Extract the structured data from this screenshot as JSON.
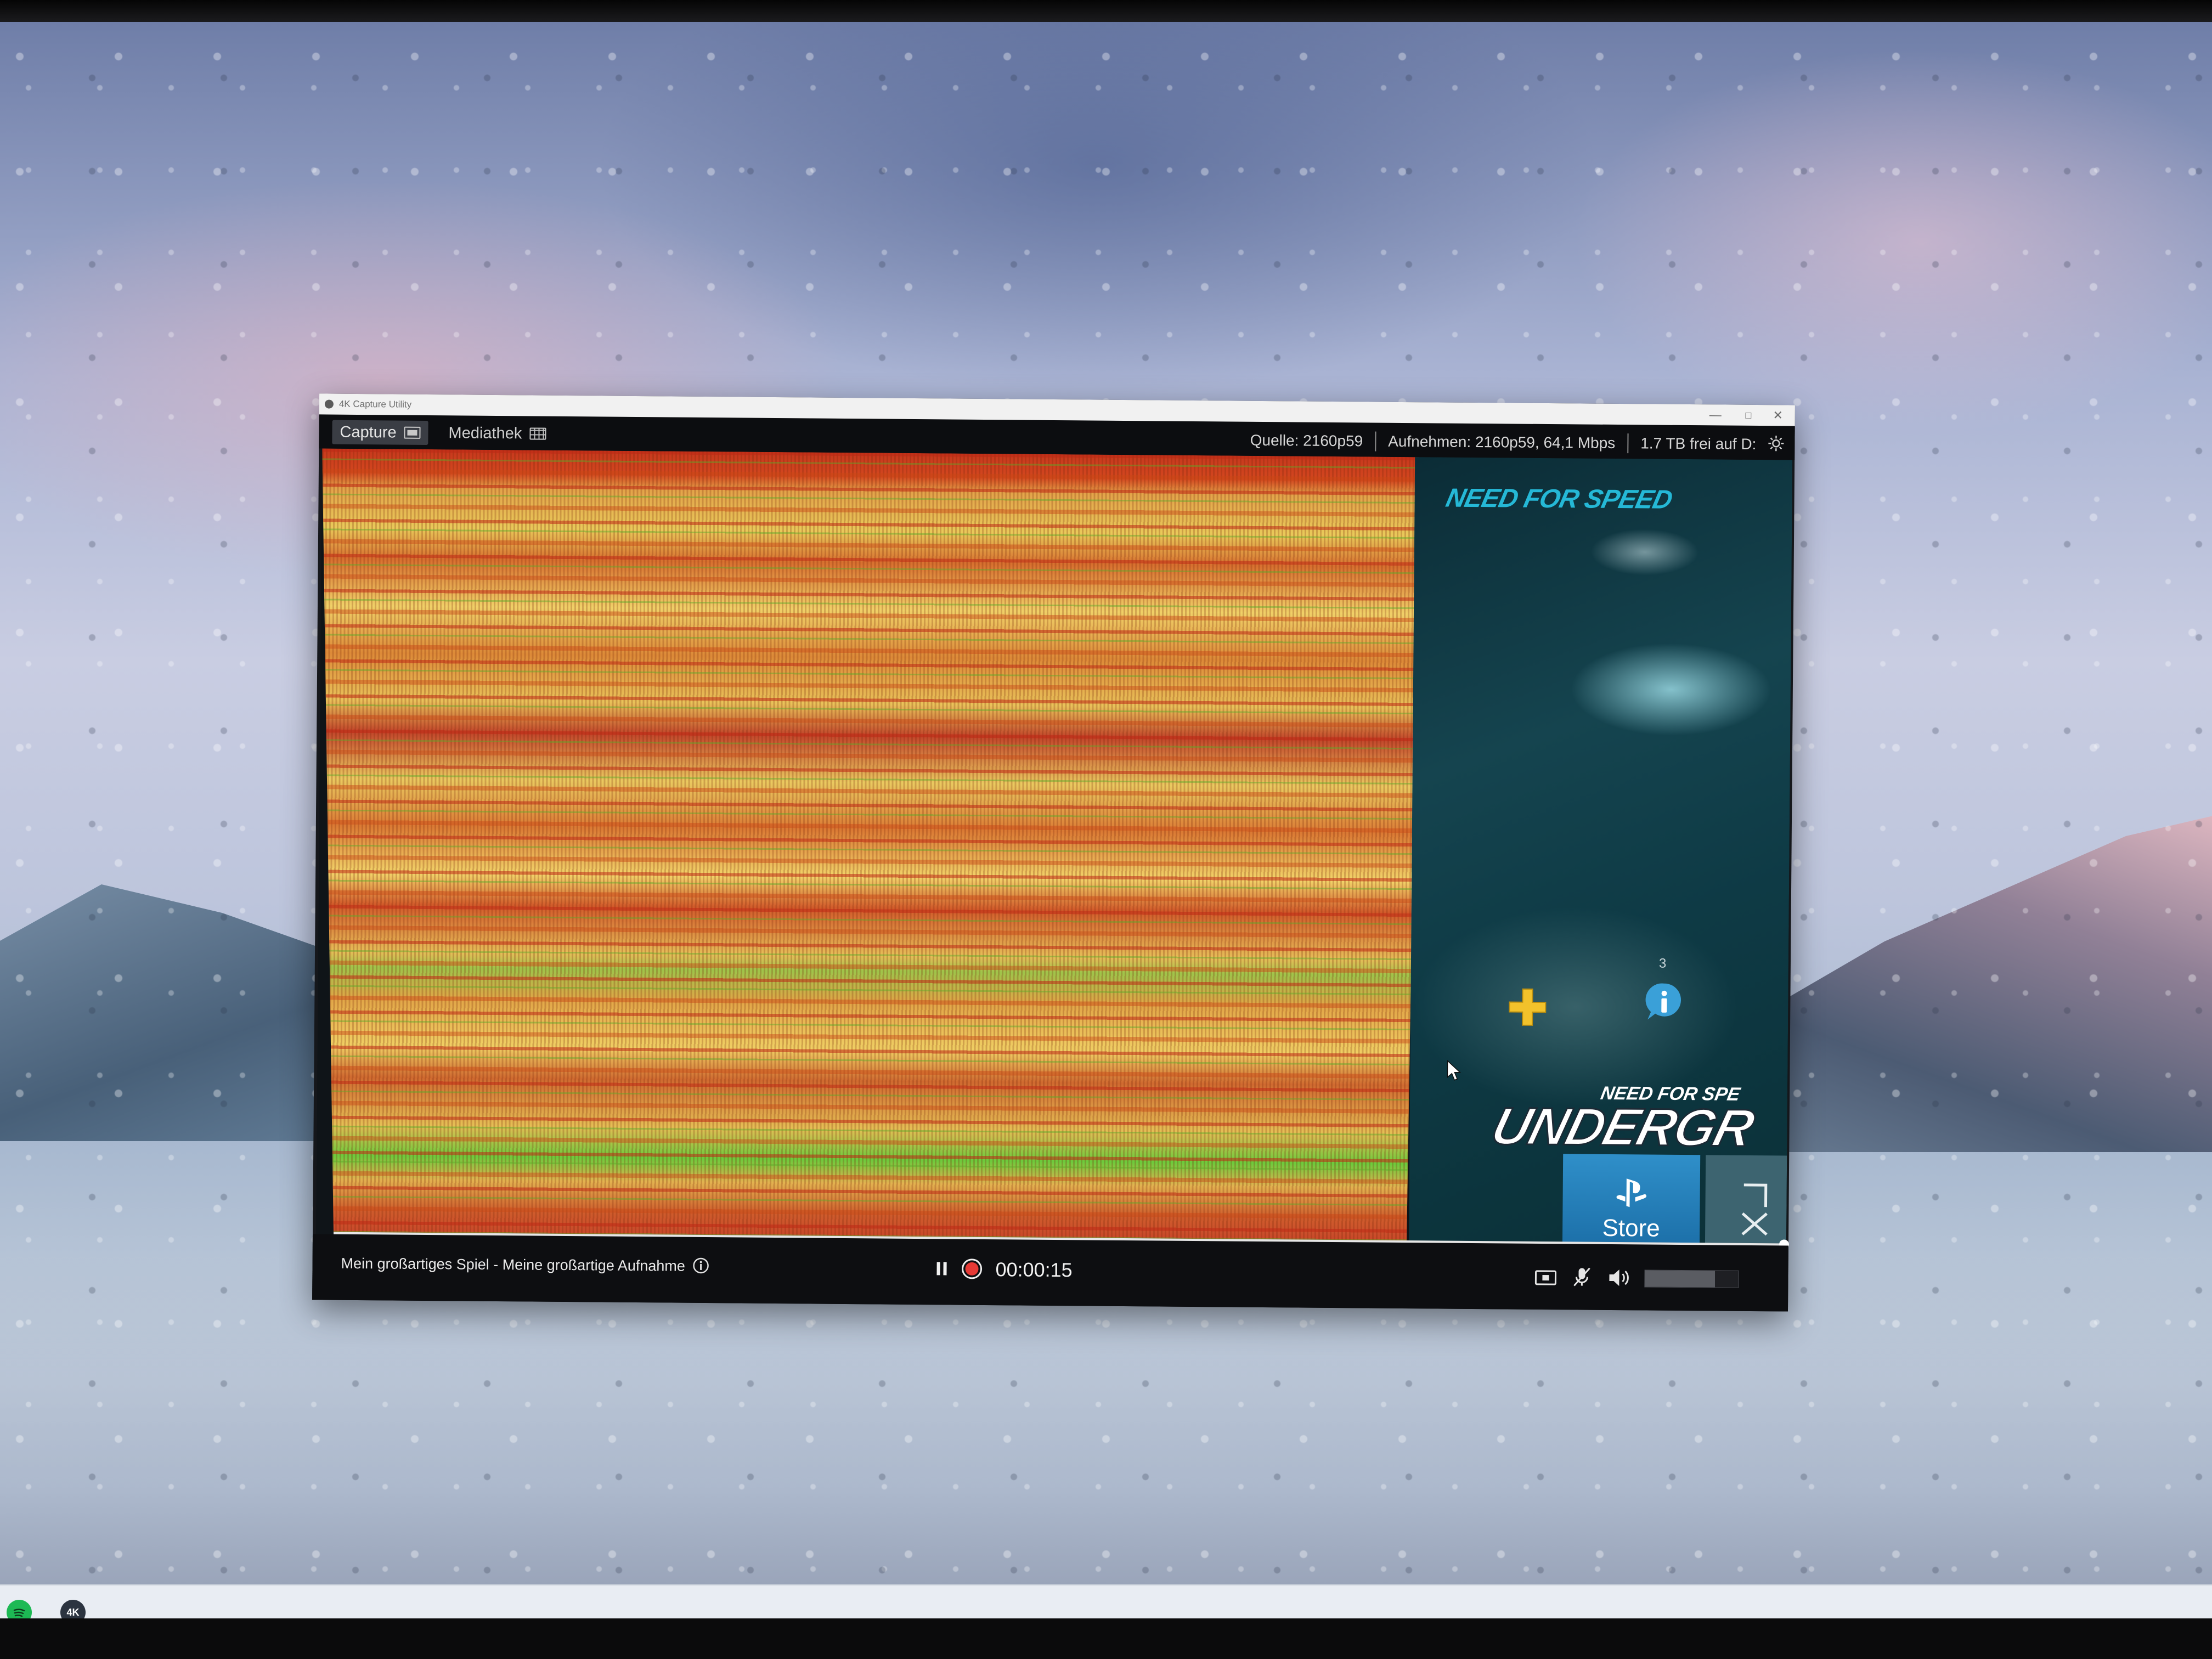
{
  "window": {
    "title": "4K Capture Utility",
    "controls": {
      "minimize": "—",
      "maximize": "□",
      "close": "✕"
    }
  },
  "tabs": [
    {
      "label": "Capture",
      "icon": "capture-view-icon",
      "active": true
    },
    {
      "label": "Mediathek",
      "icon": "grid-view-icon",
      "active": false
    }
  ],
  "status": {
    "source": "Quelle: 2160p59",
    "recording": "Aufnehmen: 2160p59, 64,1 Mbps",
    "storage": "1.7 TB frei auf D:"
  },
  "preview": {
    "left_half": "corrupted-video-artifacts",
    "game_logo": "NEED FOR SPEED",
    "notification_count": "3",
    "game_tile_subtitle": "NEED FOR SPE",
    "game_tile_title": "UNDERGR",
    "store_label": "Store",
    "icons": [
      "ps-plus-icon",
      "info-badge-icon",
      "playstation-icon",
      "cursor-icon",
      "close-icon"
    ]
  },
  "playback": {
    "session_title": "Mein großartiges Spiel - Meine großartige Aufnahme",
    "timer": "00:00:15",
    "progress": 1.0,
    "volume_level": 0.75,
    "icons": [
      "info-icon",
      "pause-icon",
      "record-icon",
      "screenshot-icon",
      "mic-muted-icon",
      "volume-icon"
    ]
  },
  "colors": {
    "record": "#e53935",
    "toolbar_bg": "#0c0d10",
    "accent_store": "#2a88c4",
    "nfs_blue": "#25b8d6"
  },
  "taskbar": {
    "apps": [
      {
        "icon": "spotify-icon",
        "label": ""
      },
      {
        "icon": "4k-app-icon",
        "label": "4K"
      }
    ]
  }
}
